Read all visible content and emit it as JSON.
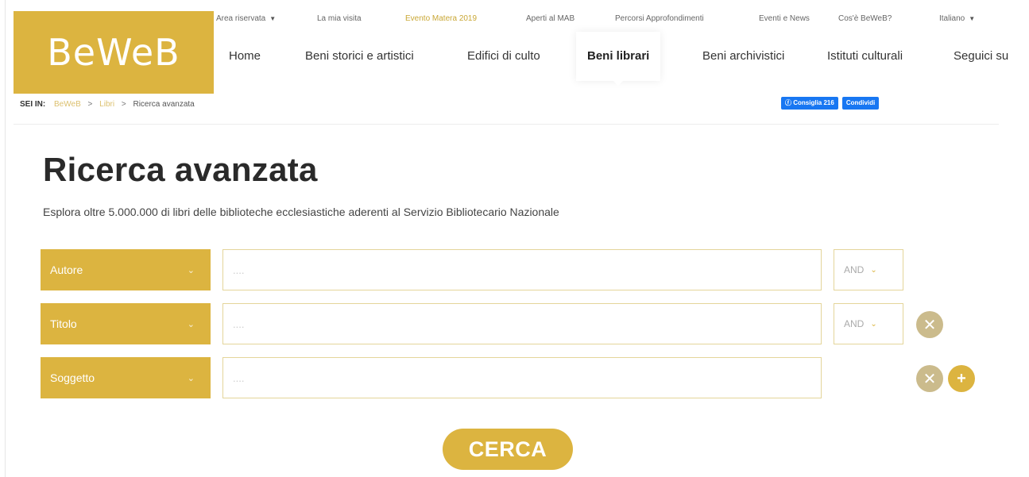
{
  "logo": {
    "text": "BeWeB"
  },
  "topnav": [
    {
      "label": "Area riservata",
      "dropdown": true
    },
    {
      "label": "La mia visita"
    },
    {
      "label": "Evento Matera 2019",
      "accent": true
    },
    {
      "label": "Aperti al MAB"
    },
    {
      "label": "Percorsi Approfondimenti"
    },
    {
      "label": "Eventi e News"
    },
    {
      "label": "Cos'è BeWeB?"
    },
    {
      "label": "Italiano",
      "dropdown": true
    }
  ],
  "mainnav": [
    {
      "label": "Home"
    },
    {
      "label": "Beni storici e artistici"
    },
    {
      "label": "Edifici di culto"
    },
    {
      "label": "Beni librari",
      "active": true
    },
    {
      "label": "Beni archivistici"
    },
    {
      "label": "Istituti culturali"
    },
    {
      "label": "Seguici su"
    }
  ],
  "breadcrumb": {
    "prefix": "SEI IN:",
    "items": [
      "BeWeB",
      "Libri",
      "Ricerca avanzata"
    ],
    "separator": ">"
  },
  "social": {
    "like_label": "Consiglia 216",
    "share_label": "Condividi"
  },
  "page": {
    "title": "Ricerca avanzata",
    "subtitle": "Esplora oltre 5.000.000 di libri delle biblioteche ecclesiastiche aderenti al Servizio Bibliotecario Nazionale"
  },
  "search_rows": [
    {
      "field": "Autore",
      "placeholder": "....",
      "operator": "AND",
      "removable": false
    },
    {
      "field": "Titolo",
      "placeholder": "....",
      "operator": "AND",
      "removable": true
    },
    {
      "field": "Soggetto",
      "placeholder": "....",
      "operator": null,
      "removable": true,
      "addable": true
    }
  ],
  "search_button": {
    "label": "CERCA"
  },
  "icons": {
    "dropdown_caret": "▼",
    "chevron": "⌄",
    "remove": "✕",
    "add": "+"
  },
  "colors": {
    "accent": "#dcb440",
    "remove_circle": "#cbbb8c",
    "facebook": "#1877f2"
  }
}
